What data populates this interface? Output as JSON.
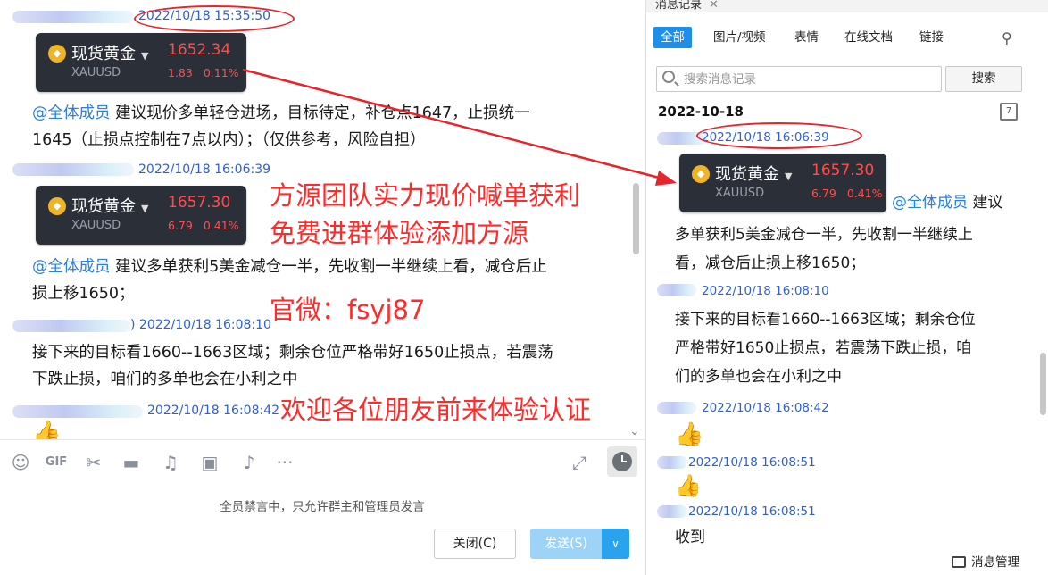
{
  "chat": {
    "messages": [
      {
        "time": "2022/10/18 15:35:50",
        "time_prefix": ""
      },
      {
        "time": "2022/10/18 16:06:39",
        "time_prefix": ""
      },
      {
        "time": "2022/10/18 16:08:10",
        "time_prefix": ")"
      },
      {
        "time": "2022/10/18 16:08:42",
        "time_prefix": ""
      }
    ],
    "card1": {
      "name": "现货黄金",
      "symbol": "XAUUSD",
      "price": "1652.34",
      "change": "1.83",
      "pct": "0.11%"
    },
    "card2": {
      "name": "现货黄金",
      "symbol": "XAUUSD",
      "price": "1657.30",
      "change": "6.79",
      "pct": "0.41%"
    },
    "mention": "@全体成员",
    "text1": "建议现价多单轻仓进场，目标待定，补仓点1647，止损统一",
    "text1b": "1645（止损点控制在7点以内）；（仅供参考，风险自担）",
    "text2": "建议多单获利5美金减仓一半，先收割一半继续上看，减仓后止",
    "text2b": "损上移1650；",
    "text3": "接下来的目标看1660--1663区域；剩余仓位严格带好1650止损点，若震荡",
    "text3b": "下跌止损，咱们的多单也会在小利之中"
  },
  "promo": {
    "line1": "方源团队实力现价喊单获利",
    "line2": "免费进群体验添加方源",
    "line3": "官微：fsyj87",
    "line4": "欢迎各位朋友前来体验认证"
  },
  "toolbar": {
    "icons": [
      "emoji-icon",
      "gif-icon",
      "scissors-icon",
      "folder-icon",
      "music-icon",
      "image-icon",
      "bell-icon",
      "more-icon"
    ],
    "mute_notice": "全员禁言中，只允许群主和管理员发言",
    "close_label": "关闭(C)",
    "send_label": "发送(S)"
  },
  "history": {
    "tab_title": "消息记录",
    "filters": [
      "全部",
      "图片/视频",
      "表情",
      "在线文档",
      "链接"
    ],
    "search_placeholder": "搜索消息记录",
    "search_label": "搜索",
    "date": "2022-10-18",
    "entries": [
      {
        "time": "2022/10/18 16:06:39"
      },
      {
        "time": "2022/10/18 16:08:10"
      },
      {
        "time": "2022/10/18 16:08:42"
      },
      {
        "time": "2022/10/18 16:08:51"
      },
      {
        "time": "2022/10/18 16:08:51"
      }
    ],
    "card": {
      "name": "现货黄金",
      "symbol": "XAUUSD",
      "price": "1657.30",
      "change": "6.79",
      "pct": "0.41%"
    },
    "mention": "@全体成员",
    "t1a": "建议",
    "t1b": "多单获利5美金减仓一半，先收割一半继续上",
    "t1c": "看，减仓后止损上移1650；",
    "t2a": "接下来的目标看1660--1663区域；剩余仓位",
    "t2b": "严格带好1650止损点，若震荡下跌止损，咱",
    "t2c": "们的多单也会在小利之中",
    "last": "收到",
    "mgmt_label": "消息管理"
  },
  "colors": {
    "accent": "#1e8ee8",
    "annotation": "#ff2a2a",
    "price_up": "#ff4d4d",
    "timestamp": "#2f5fd3"
  }
}
